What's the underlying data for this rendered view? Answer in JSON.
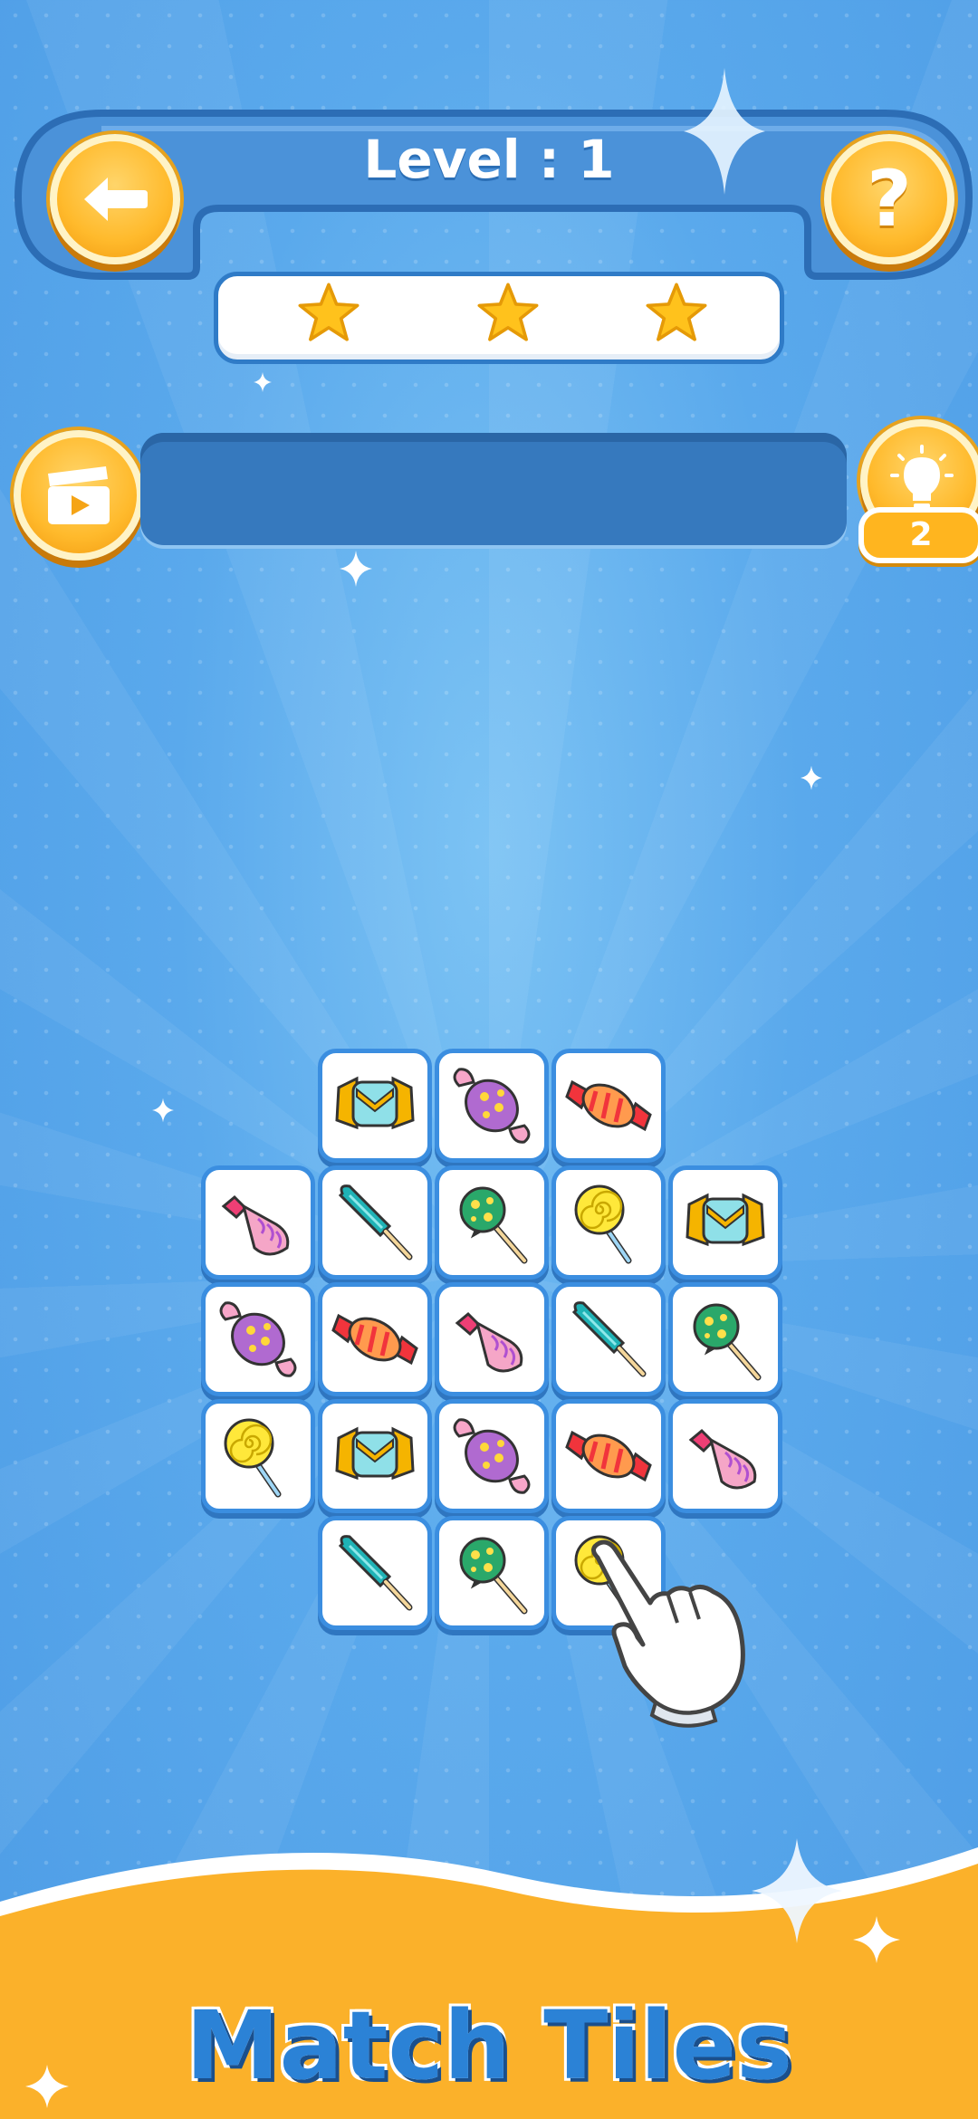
{
  "header": {
    "level_label": "Level : 1",
    "back_icon": "arrow-left-icon",
    "help_label": "?"
  },
  "stars": {
    "earned": 3,
    "total": 3,
    "icon": "star-icon"
  },
  "powerups": {
    "video_icon": "clapperboard-icon",
    "hint_icon": "lightbulb-icon",
    "hint_count": "2"
  },
  "board": {
    "tiles": [
      {
        "row": 0,
        "col": 1,
        "item": "yellow-wrapped-candy"
      },
      {
        "row": 0,
        "col": 2,
        "item": "purple-star-candy"
      },
      {
        "row": 0,
        "col": 3,
        "item": "red-striped-candy"
      },
      {
        "row": 1,
        "col": 0,
        "item": "pink-cone-candy"
      },
      {
        "row": 1,
        "col": 1,
        "item": "teal-ice-pop"
      },
      {
        "row": 1,
        "col": 2,
        "item": "green-dotted-lollipop"
      },
      {
        "row": 1,
        "col": 3,
        "item": "yellow-swirl-lollipop"
      },
      {
        "row": 1,
        "col": 4,
        "item": "yellow-wrapped-candy"
      },
      {
        "row": 2,
        "col": 0,
        "item": "purple-star-candy"
      },
      {
        "row": 2,
        "col": 1,
        "item": "red-striped-candy"
      },
      {
        "row": 2,
        "col": 2,
        "item": "pink-cone-candy"
      },
      {
        "row": 2,
        "col": 3,
        "item": "teal-ice-pop"
      },
      {
        "row": 2,
        "col": 4,
        "item": "green-dotted-lollipop"
      },
      {
        "row": 3,
        "col": 0,
        "item": "yellow-swirl-lollipop"
      },
      {
        "row": 3,
        "col": 1,
        "item": "yellow-wrapped-candy"
      },
      {
        "row": 3,
        "col": 2,
        "item": "purple-star-candy"
      },
      {
        "row": 3,
        "col": 3,
        "item": "red-striped-candy"
      },
      {
        "row": 3,
        "col": 4,
        "item": "pink-cone-candy"
      },
      {
        "row": 4,
        "col": 1,
        "item": "teal-ice-pop"
      },
      {
        "row": 4,
        "col": 2,
        "item": "green-dotted-lollipop"
      },
      {
        "row": 4,
        "col": 3,
        "item": "yellow-swirl-lollipop"
      }
    ],
    "pointer_icon": "pointing-hand-icon"
  },
  "footer": {
    "title": "Match Tiles"
  },
  "colors": {
    "background": "#5aa9ec",
    "banner": "#3f86cf",
    "button_gold": "#ffba2c",
    "footer": "#fbb12a",
    "title_blue": "#2b82d6"
  }
}
